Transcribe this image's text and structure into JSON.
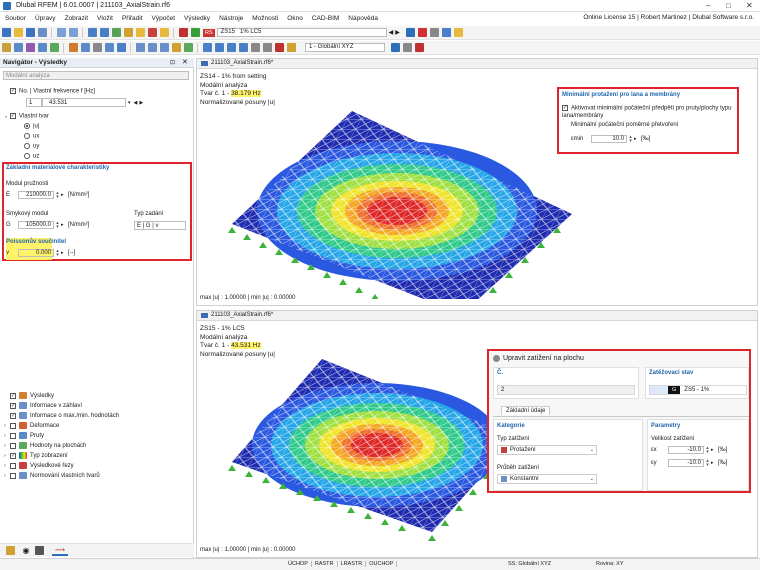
{
  "app": {
    "title": "Dlubal RFEM | 6.01.0007 | 211103_AxialStrain.rf6",
    "license": "Online License 15 | Robert Martinez | Dlubal Software s.r.o."
  },
  "menu": [
    "Soubor",
    "Úpravy",
    "Zobrazit",
    "Vložit",
    "Přiřadit",
    "Výpočet",
    "Výsledky",
    "Nástroje",
    "Možnosti",
    "Okno",
    "CAD-BIM",
    "Nápověda"
  ],
  "toolbar": {
    "load_case_tag": "RS",
    "load_case_name": "ZS15",
    "load_case_desc": "1% LC5",
    "coord_system": "1 - Globální XYZ"
  },
  "navigator": {
    "title": "Navigátor - Výsledky",
    "analysis_combo": "Modální analýza",
    "freq_label": "No. | Vlastní frekvence f [Hz]",
    "freq_no": "1",
    "freq_value": "43.531",
    "mode_shape_label": "Vlastní tvar",
    "mode_options": [
      "|u|",
      "ux",
      "uy",
      "uz"
    ],
    "material_section": "Základní materiálové charakteristiky",
    "elastic_modulus_label": "Modul pružnosti",
    "E_symbol": "E",
    "E_value": "210000.0",
    "E_unit": "[N/mm²]",
    "shear_modulus_label": "Smykový modul",
    "G_symbol": "G",
    "G_value": "105000.0",
    "G_unit": "[N/mm²]",
    "input_type_label": "Typ zadání",
    "input_type_value": "E | G | v",
    "poisson_label": "Poissonův součinitel",
    "nu_symbol": "v",
    "nu_value": "0.000",
    "nu_unit": "[--]",
    "tree": [
      {
        "label": "Výsledky",
        "checked": true
      },
      {
        "label": "Informace v záhlaví",
        "checked": true
      },
      {
        "label": "Informace o max./min. hodnotách",
        "checked": true
      },
      {
        "label": "Deformace",
        "checked": false
      },
      {
        "label": "Pruty",
        "checked": false
      },
      {
        "label": "Hodnoty na plochách",
        "checked": false
      },
      {
        "label": "Typ zobrazení",
        "checked": true
      },
      {
        "label": "Výsledkové řezy",
        "checked": false
      },
      {
        "label": "Normování vlastních tvarů",
        "checked": false
      }
    ]
  },
  "viewport1": {
    "tab": "211103_AxialStrain.rf6*",
    "line1": "ZS14 - 1% from setting",
    "line2": "Modální analýza",
    "line3_prefix": "Tvar č. 1 - ",
    "freq": "38.179 Hz",
    "line4": "Normalizované posuny |u|",
    "footer": "max |u| : 1.00000 | min |u| : 0.00000"
  },
  "viewport2": {
    "tab": "211103_AxialStrain.rf6*",
    "line1": "ZS15 - 1% LC5",
    "line2": "Modální analýza",
    "line3_prefix": "Tvar č. 1 - ",
    "freq": "43.531 Hz",
    "line4": "Normalizované posuny |u|",
    "footer": "max |u| : 1.00000 | min |u| : 0.00000"
  },
  "dialog1": {
    "title": "Minimální protažení pro lana a membrány",
    "check_label": "Aktivovat minimální počáteční předpětí pro pruty/plochy typu lana/membrány",
    "strain_label": "Minimální počáteční poměrné přetvoření",
    "symbol": "εmin",
    "value": "10.0",
    "unit": "[‰]"
  },
  "dialog2": {
    "title": "Upravit zatížení na plochu",
    "no_label": "Č.",
    "no_value": "2",
    "lc_label": "Zatěžovací stav",
    "lc_tag": "G",
    "lc_value": "ZS5 - 1%",
    "tab_basic": "Základní údaje",
    "category_label": "Kategorie",
    "load_type_label": "Typ zatížení",
    "load_type_value": "Protažení",
    "distribution_label": "Průběh zatížení",
    "distribution_value": "Konstantní",
    "params_label": "Parametry",
    "magnitude_label": "Velikost zatížení",
    "ex_symbol": "εx",
    "ex_value": "-10.0",
    "ex_unit": "[‰]",
    "ey_symbol": "εy",
    "ey_value": "-10.0",
    "ey_unit": "[‰]"
  },
  "statusbar": {
    "items": [
      "ÚCHOP",
      "RASTR",
      "LRASTR",
      "OUCHOP"
    ],
    "cs": "SS: Globální XYZ",
    "plane": "Rovina: XY"
  }
}
